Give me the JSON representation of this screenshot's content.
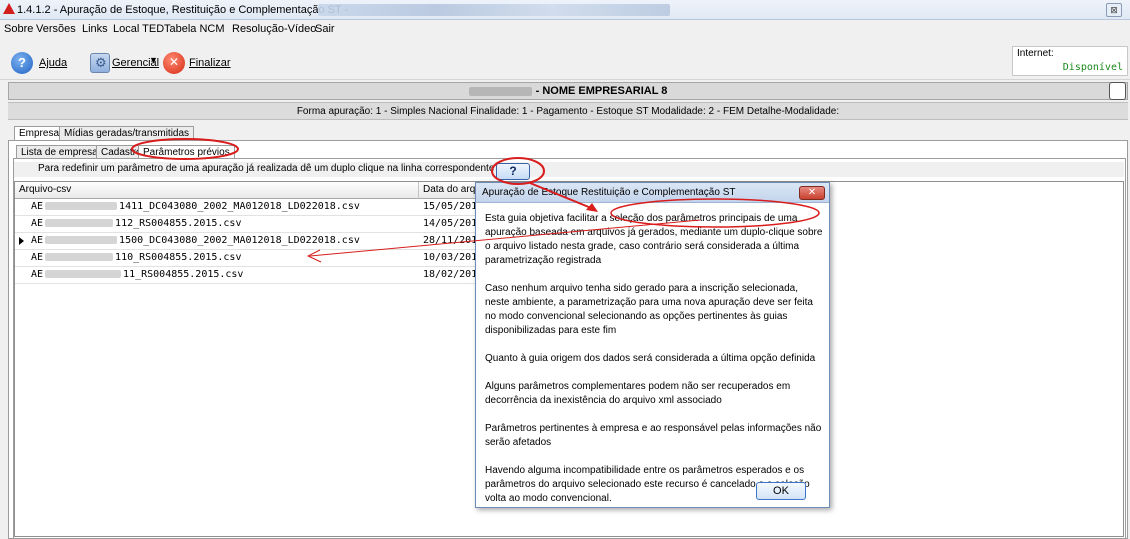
{
  "window": {
    "title": "1.4.1.2 - Apuração de Estoque, Restituição e Complementação ST - ",
    "close_symbol": "⊠"
  },
  "menu": [
    "Sobre",
    "Versões",
    "Links",
    "Local TED",
    "Tabela NCM",
    "Resolução-Vídeo",
    "Sair"
  ],
  "toolbar": {
    "help_label": "Ajuda",
    "manage_label": "Gerencial",
    "finish_label": "Finalizar"
  },
  "internet": {
    "label": "Internet:",
    "status": "Disponível"
  },
  "company": {
    "name": "- NOME EMPRESARIAL 8"
  },
  "forma_info": "Forma apuração: 1 - Simples Nacional   Finalidade: 1 - Pagamento - Estoque ST   Modalidade: 2 - FEM   Detalhe-Modalidade:",
  "tabs_outer": [
    "Empresas",
    "Mídias geradas/transmitidas"
  ],
  "tabs_inner": [
    "Lista de empresas",
    "Cadastro",
    "Parâmetros prévios"
  ],
  "hint": "Para redefinir um parâmetro de uma apuração já realizada dê um duplo clique na linha correspondente",
  "help_button": "?",
  "grid": {
    "headers": [
      "Arquivo-csv",
      "Data do arquiv"
    ],
    "rows": [
      {
        "prefix": "AE",
        "suffix": "1411_DC043080_2002_MA012018_LD022018.csv",
        "date": "15/05/201"
      },
      {
        "prefix": "AE",
        "suffix": "112_RS004855.2015.csv",
        "date": "14/05/201"
      },
      {
        "prefix": "AE",
        "suffix": "1500_DC043080_2002_MA012018_LD022018.csv",
        "date": "28/11/201"
      },
      {
        "prefix": "AE",
        "suffix": "110_RS004855.2015.csv",
        "date": "10/03/201"
      },
      {
        "prefix": "AE",
        "suffix": "11_RS004855.2015.csv",
        "date": "18/02/201"
      }
    ]
  },
  "dialog": {
    "title": "Apuração de Estoque Restituição e Complementação ST",
    "paragraphs": [
      "Esta guia objetiva facilitar a seleção dos parâmetros principais de uma apuração baseada em arquivos já gerados, mediante um duplo-clique sobre o arquivo listado nesta grade, caso contrário será considerada a última parametrização registrada",
      "Caso nenhum arquivo tenha sido gerado para a inscrição selecionada, neste ambiente, a parametrização para uma nova apuração deve ser feita no modo convencional selecionando as opções pertinentes às guias disponibilizadas para este fim",
      "Quanto à guia origem dos dados será considerada a última opção definida",
      "Alguns parâmetros complementares podem não ser recuperados em decorrência da inexistência do arquivo xml associado",
      "Parâmetros pertinentes à empresa e ao responsável pelas informações não serão afetados",
      "Havendo alguma incompatibilidade entre os parâmetros esperados e os parâmetros do arquivo selecionado este recurso é cancelado e a seleção volta ao modo convencional."
    ],
    "ok_label": "OK",
    "close_symbol": "✕"
  },
  "colors": {
    "annotation": "#d91c1c",
    "internet_ok": "#1a8a1a"
  }
}
